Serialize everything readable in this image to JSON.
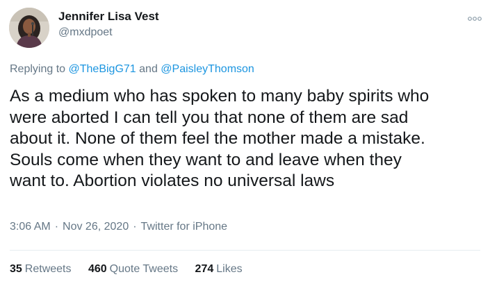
{
  "author": {
    "display_name": "Jennifer Lisa Vest",
    "handle": "@mxdpoet"
  },
  "reply": {
    "prefix": "Replying to",
    "mention_1": "@TheBigG71",
    "conjunction": "and",
    "mention_2": "@PaisleyThomson"
  },
  "tweet": {
    "text": "As a medium who has spoken to many baby spirits who\nwere aborted I can tell you that none of them are sad\nabout it. None of them feel the mother made a mistake.\nSouls come when they want to and leave when they\nwant to. Abortion violates no universal laws"
  },
  "meta": {
    "time": "3:06 AM",
    "separator": "·",
    "date": "Nov 26, 2020",
    "source": "Twitter for iPhone"
  },
  "stats": {
    "retweets_count": "35",
    "retweets_label": "Retweets",
    "quotes_count": "460",
    "quotes_label": "Quote Tweets",
    "likes_count": "274",
    "likes_label": "Likes"
  },
  "colors": {
    "link": "#1b95e0",
    "secondary_text": "#657786",
    "primary_text": "#14171a",
    "divider": "#e6ecf0"
  },
  "icons": {
    "more": "more-dots-icon",
    "avatar": "profile-photo"
  }
}
